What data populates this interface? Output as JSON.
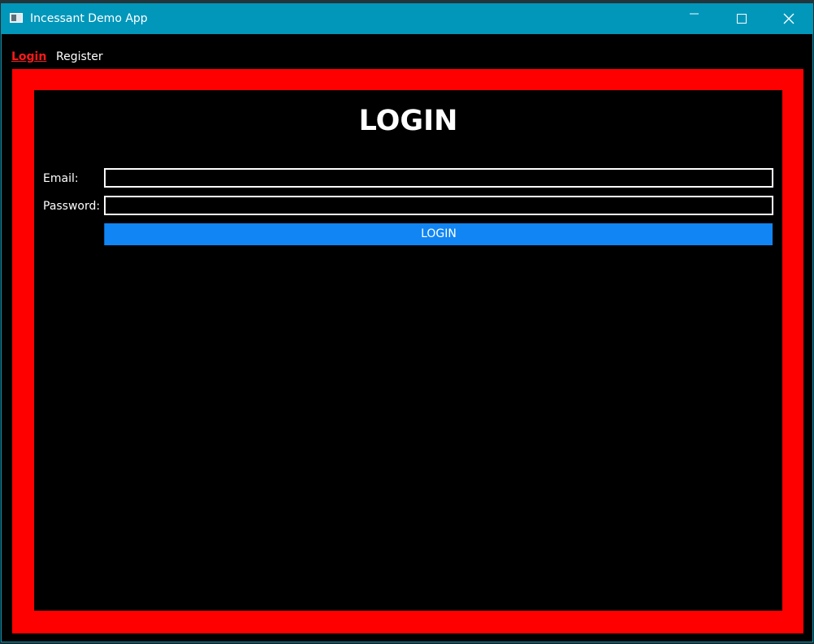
{
  "window": {
    "title": "Incessant Demo App"
  },
  "titlebar_buttons": {
    "minimize_icon": "minimize-icon",
    "maximize_icon": "maximize-icon",
    "close_icon": "close-icon"
  },
  "menu": {
    "items": [
      {
        "label": "Login",
        "active": true
      },
      {
        "label": "Register",
        "active": false
      }
    ]
  },
  "login_form": {
    "heading": "LOGIN",
    "email_label": "Email:",
    "email_value": "",
    "password_label": "Password:",
    "password_value": "",
    "submit_label": "LOGIN"
  },
  "colors": {
    "titlebar": "#0097bb",
    "frame_border": "#ff0000",
    "active_menu": "#ff1a1a",
    "button": "#1185f3",
    "background": "#000000"
  }
}
